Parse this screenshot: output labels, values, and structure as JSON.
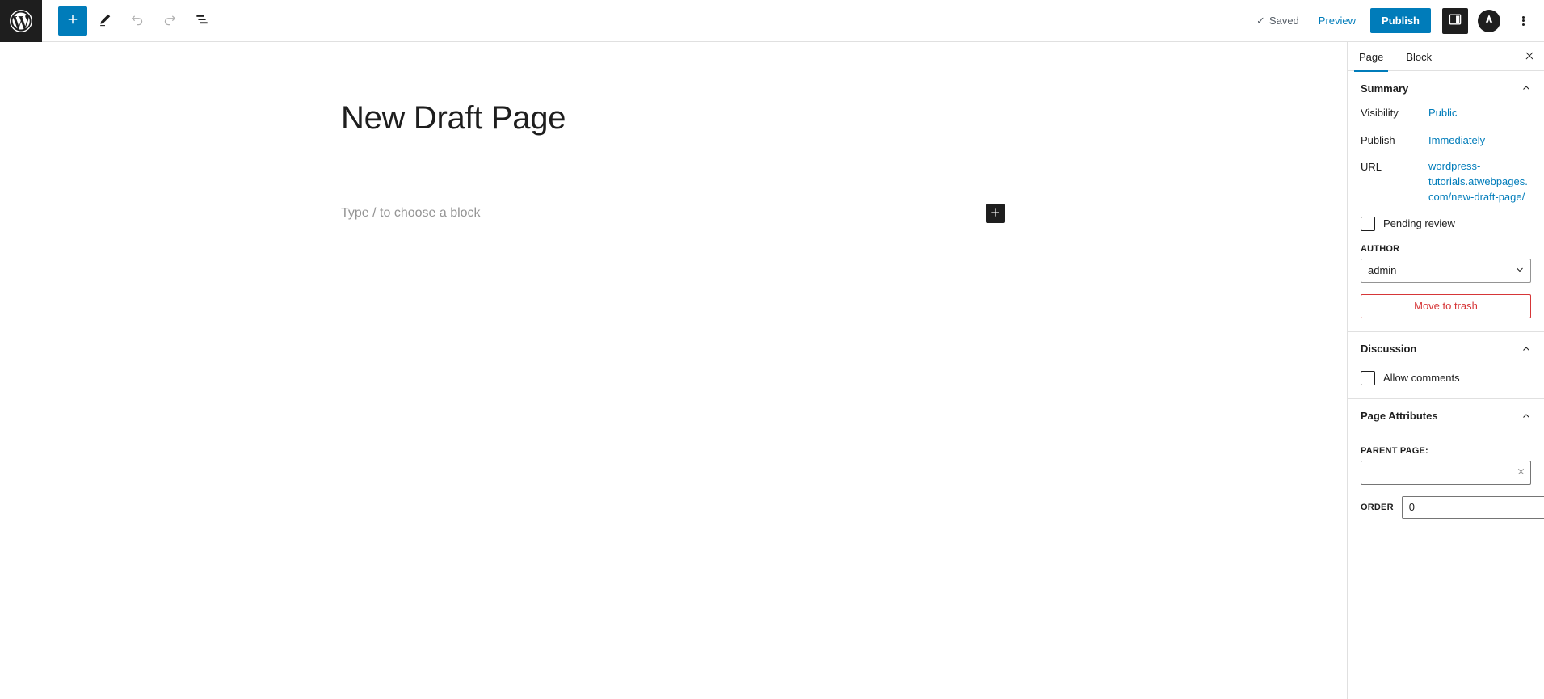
{
  "toolbar": {
    "logo_icon": "wordpress-logo-icon",
    "add_block_label": "+",
    "add_block_icon": "plus-icon",
    "tools_icon": "pencil-edit-icon",
    "undo_icon": "undo-arrow-icon",
    "redo_icon": "redo-arrow-icon",
    "details_icon": "document-overview-icon",
    "saved_status": "Saved",
    "saved_check": "✓",
    "preview_label": "Preview",
    "publish_label": "Publish",
    "sidebar_toggle_icon": "settings-panel-icon",
    "avatar_icon": "jetpack-avatar-icon",
    "options_icon": "kebab-menu-icon"
  },
  "editor": {
    "title": "New Draft Page",
    "block_placeholder": "Type / to choose a block",
    "inserter_icon": "plus-icon"
  },
  "sidebar": {
    "tabs": [
      {
        "label": "Page",
        "active": true
      },
      {
        "label": "Block",
        "active": false
      }
    ],
    "close_icon": "close-x-icon",
    "summary": {
      "title": "Summary",
      "collapse_icon": "chevron-up-icon",
      "rows": [
        {
          "label": "Visibility",
          "value": "Public"
        },
        {
          "label": "Publish",
          "value": "Immediately"
        },
        {
          "label": "URL",
          "value": "wordpress-tutorials.atwebpages.com/new-draft-page/"
        }
      ],
      "pending_review_label": "Pending review",
      "pending_review_checked": false,
      "author_label": "AUTHOR",
      "author_value": "admin",
      "author_options": [
        "admin"
      ],
      "trash_label": "Move to trash"
    },
    "discussion": {
      "title": "Discussion",
      "collapse_icon": "chevron-up-icon",
      "allow_comments_label": "Allow comments",
      "allow_comments_checked": false
    },
    "page_attributes": {
      "title": "Page Attributes",
      "collapse_icon": "chevron-up-icon",
      "parent_page_label": "PARENT PAGE:",
      "parent_page_value": "",
      "parent_clear_icon": "clear-x-icon",
      "order_label": "ORDER",
      "order_value": "0"
    }
  },
  "colors": {
    "accent": "#007cba",
    "danger": "#d63638",
    "dark": "#1e1e1e",
    "muted": "#949494",
    "border": "#e0e0e0"
  }
}
